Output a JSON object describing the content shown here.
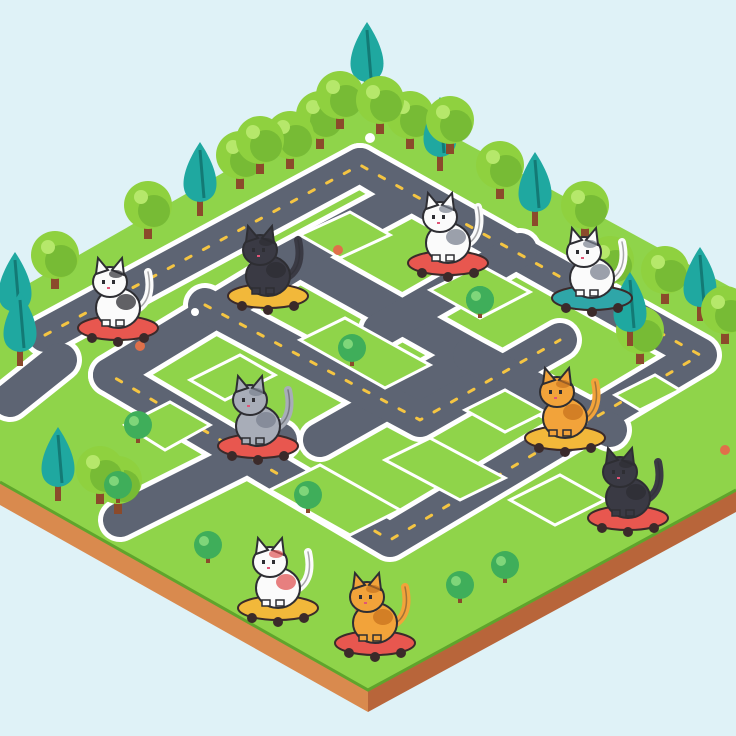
{
  "scene": {
    "style": "isometric pixel-art",
    "colors": {
      "sky": "#dff2f7",
      "grass": "#8fd44a",
      "grass_dark": "#6fb536",
      "road": "#5d6473",
      "road_edge": "#ffffff",
      "road_dash": "#f5c542",
      "dirt_top": "#d98a4e",
      "dirt_side": "#b8653a",
      "tree_round": "#8fd13f",
      "tree_round_dark": "#5fa52c",
      "tree_cone": "#1fa8a0",
      "trunk": "#8b4a2b",
      "skate_red": "#e8574f",
      "skate_yellow": "#f2b83a",
      "skate_teal": "#2fa6a8"
    }
  },
  "cats": [
    {
      "name": "cat-white-black-topleft",
      "fur": "white",
      "patch": "#2e2e33",
      "board": "red"
    },
    {
      "name": "cat-black-top",
      "fur": "black",
      "patch": "#2e2e33",
      "board": "yellow"
    },
    {
      "name": "cat-grey-tabby-top",
      "fur": "white",
      "patch": "#7b8290",
      "board": "red"
    },
    {
      "name": "cat-white-grey-right",
      "fur": "white",
      "patch": "#7b8290",
      "board": "teal"
    },
    {
      "name": "cat-grey-tabby-middle",
      "fur": "grey",
      "patch": "#7b8290",
      "board": "red"
    },
    {
      "name": "cat-orange-right",
      "fur": "orange",
      "patch": "#c8731f",
      "board": "yellow"
    },
    {
      "name": "cat-black-right",
      "fur": "black",
      "patch": "#2e2e33",
      "board": "red"
    },
    {
      "name": "cat-white-bottom",
      "fur": "white",
      "patch": "#e05555",
      "board": "yellow"
    },
    {
      "name": "cat-orange-bottom",
      "fur": "orange",
      "patch": "#c8731f",
      "board": "red"
    }
  ],
  "trees": {
    "round_count": 18,
    "cone_count": 9
  },
  "bushes": {
    "count": 9
  }
}
